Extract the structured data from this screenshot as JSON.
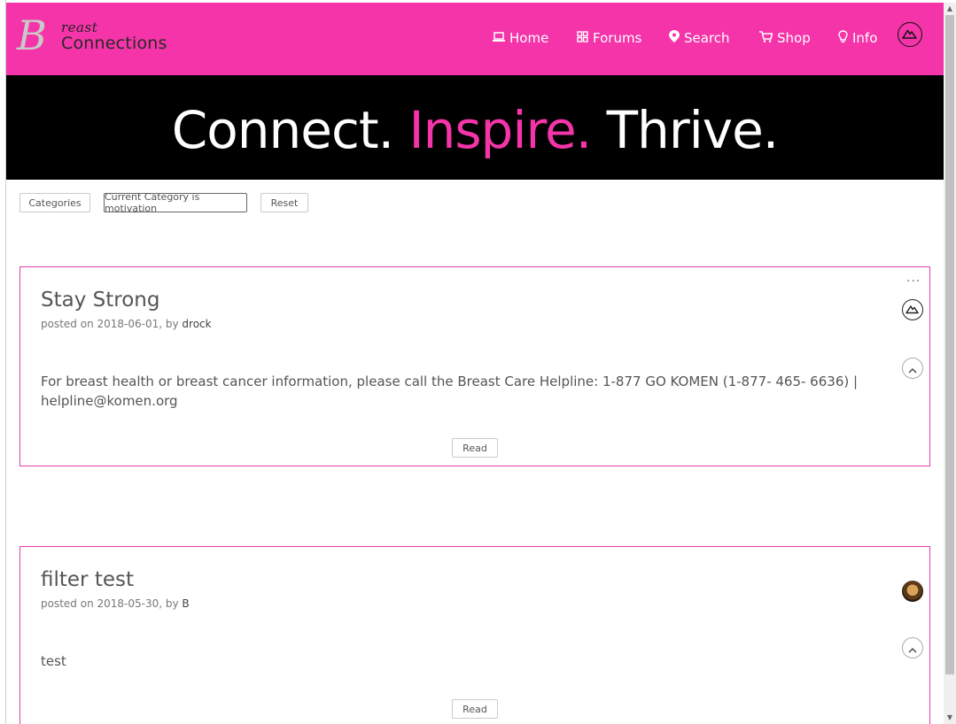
{
  "header": {
    "logo_b": "B",
    "logo_reast": "reast",
    "logo_connections": "Connections",
    "nav": {
      "home": "Home",
      "forums": "Forums",
      "search": "Search",
      "shop": "Shop",
      "info": "Info"
    }
  },
  "banner": {
    "part1": "Connect. ",
    "part2": "Inspire.",
    "part3": " Thrive."
  },
  "filters": {
    "categories": "Categories",
    "current": "Current Category is motivation",
    "reset": "Reset"
  },
  "posts": [
    {
      "title": "Stay Strong",
      "meta_prefix": "posted on 2018-06-01, by ",
      "author": "drock",
      "body": "For breast health or breast cancer information, please call the Breast Care Helpline: 1-877 GO KOMEN (1-877- 465- 6636) | helpline@komen.org",
      "read": "Read",
      "more": "..."
    },
    {
      "title": "filter test",
      "meta_prefix": "posted on 2018-05-30, by ",
      "author": "B",
      "body": "test",
      "read": "Read"
    }
  ],
  "colors": {
    "brand_pink": "#f434a8",
    "banner_bg": "#000000",
    "card_border": "#e040a8"
  },
  "icons": {
    "home": "laptop-icon",
    "forums": "grid-icon",
    "search": "map-pin-icon",
    "shop": "cart-icon",
    "info": "lightbulb-icon",
    "avatar": "mountain-logo-icon",
    "collapse": "chevron-up-icon"
  }
}
